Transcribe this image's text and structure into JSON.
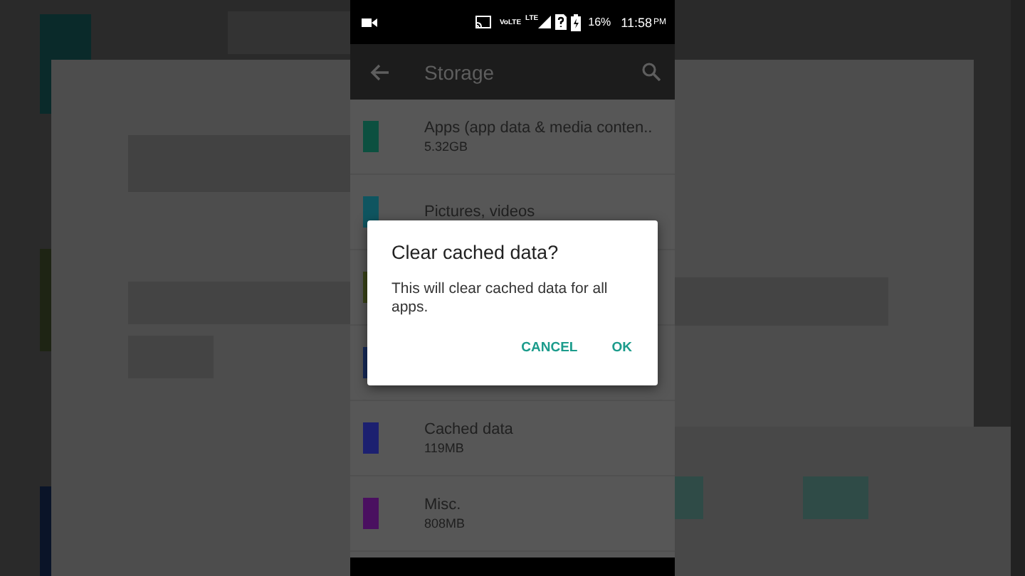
{
  "status_bar": {
    "network": "VoLTE",
    "network_type": "LTE",
    "battery": "16%",
    "time": "11:58",
    "meridiem": "PM"
  },
  "toolbar": {
    "title": "Storage"
  },
  "rows": [
    {
      "title": "Apps (app data & media conten..",
      "size": "5.32GB",
      "color": "#0c5040"
    },
    {
      "title": "Pictures, videos",
      "color": "#0f5560"
    },
    {
      "color": "#3a4418"
    },
    {
      "color": "#162a5a"
    },
    {
      "title": "Cached data",
      "size": "119MB",
      "color": "#1c2070"
    },
    {
      "title": "Misc.",
      "size": "808MB",
      "color": "#4a1060"
    }
  ],
  "dialog": {
    "title": "Clear cached data?",
    "message": "This will clear cached data for all apps.",
    "buttons": [
      "CANCEL",
      "OK"
    ]
  }
}
